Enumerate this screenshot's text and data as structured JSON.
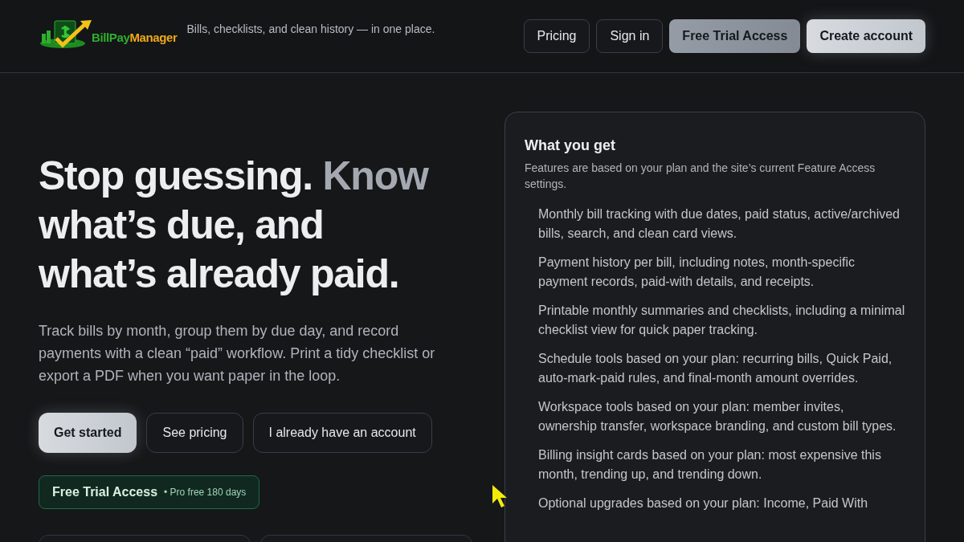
{
  "header": {
    "logo": {
      "word_1": "BillPay",
      "word_2": "Manager"
    },
    "tagline": "Bills, checklists, and clean history — in one place.",
    "nav": [
      {
        "label": "Pricing",
        "kind": "outline"
      },
      {
        "label": "Sign in",
        "kind": "outline"
      },
      {
        "label": "Free Trial Access",
        "kind": "muted"
      },
      {
        "label": "Create account",
        "kind": "primary"
      }
    ]
  },
  "hero": {
    "headline_lead": "Stop guessing.",
    "headline_accent": "Know",
    "headline_rest": "what’s due, and what’s already paid.",
    "description": "Track bills by month, group them by due day, and record payments with a clean “paid” workflow. Print a tidy checklist or export a PDF when you want paper in the loop.",
    "actions": [
      {
        "label": "Get started",
        "kind": "primary"
      },
      {
        "label": "See pricing",
        "kind": "outline"
      },
      {
        "label": "I already have an account",
        "kind": "outline"
      }
    ],
    "trial_badge": {
      "title": "Free Trial Access",
      "note": "• Pro free 180 days"
    }
  },
  "features": {
    "title": "What you get",
    "subtitle": "Features are based on your plan and the site’s current Feature Access settings.",
    "items": [
      "Monthly bill tracking with due dates, paid status, active/archived bills, search, and clean card views.",
      "Payment history per bill, including notes, month-specific payment records, paid-with details, and receipts.",
      "Printable monthly summaries and checklists, including a minimal checklist view for quick paper tracking.",
      "Schedule tools based on your plan: recurring bills, Quick Paid, auto-mark-paid rules, and final-month amount overrides.",
      "Workspace tools based on your plan: member invites, ownership transfer, workspace branding, and custom bill types.",
      "Billing insight cards based on your plan: most expensive this month, trending up, and trending down.",
      "Optional upgrades based on your plan: Income, Paid With"
    ]
  }
}
